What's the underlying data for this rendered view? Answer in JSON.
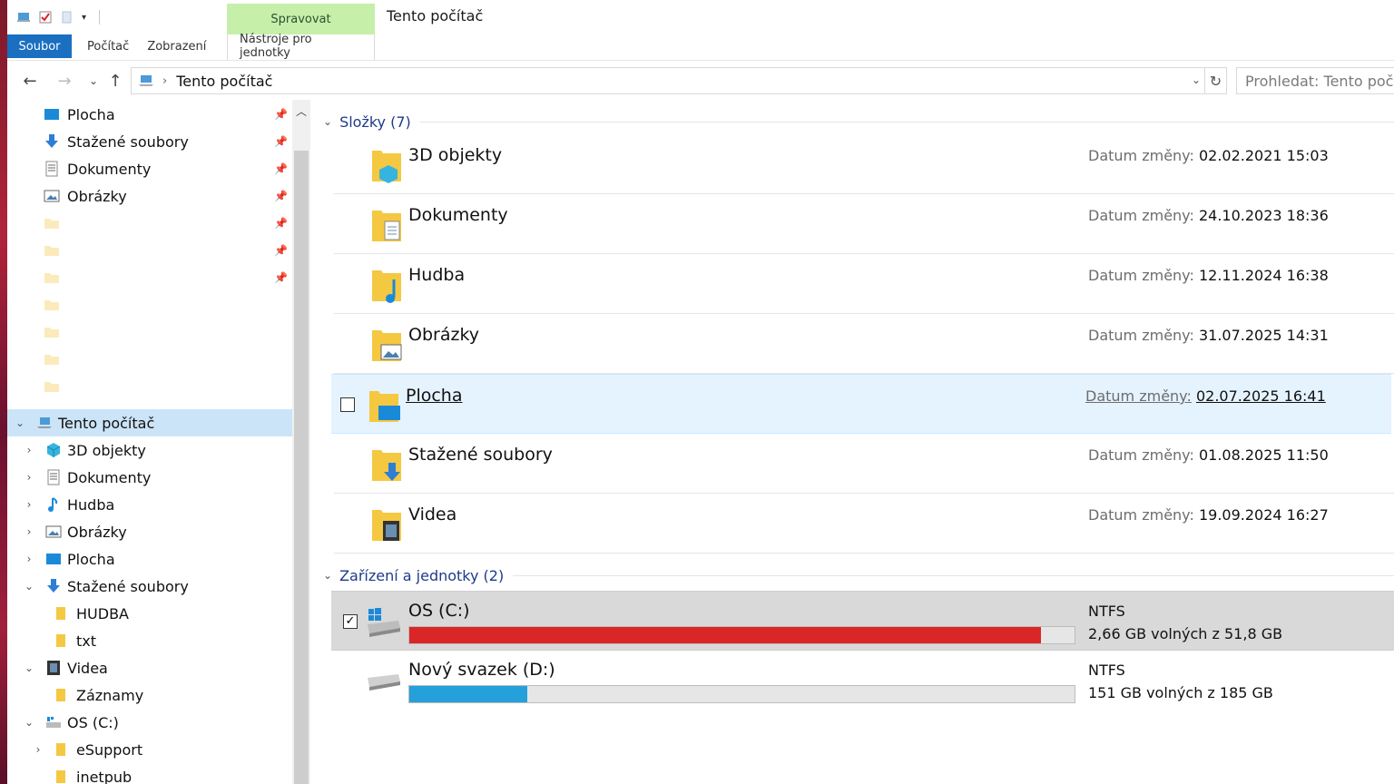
{
  "window": {
    "title": "Tento počítač"
  },
  "ribbon": {
    "context_group": "Spravovat",
    "tabs": [
      {
        "label": "Soubor"
      },
      {
        "label": "Počítač"
      },
      {
        "label": "Zobrazení"
      },
      {
        "label": "Nástroje pro jednotky"
      }
    ]
  },
  "address": {
    "breadcrumb": "Tento počítač",
    "search_placeholder": "Prohledat: Tento počítač"
  },
  "nav": {
    "quick_access": [
      {
        "label": "Plocha",
        "icon": "desktop-icon",
        "pinned": true
      },
      {
        "label": "Stažené soubory",
        "icon": "download-arrow-icon",
        "pinned": true
      },
      {
        "label": "Dokumenty",
        "icon": "document-icon",
        "pinned": true
      },
      {
        "label": "Obrázky",
        "icon": "picture-icon",
        "pinned": true
      }
    ],
    "this_pc": {
      "label": "Tento počítač"
    },
    "tree": [
      {
        "label": "3D objekty",
        "icon": "3d-cube-icon"
      },
      {
        "label": "Dokumenty",
        "icon": "document-icon"
      },
      {
        "label": "Hudba",
        "icon": "music-note-icon"
      },
      {
        "label": "Obrázky",
        "icon": "picture-icon"
      },
      {
        "label": "Plocha",
        "icon": "desktop-icon"
      },
      {
        "label": "Stažené soubory",
        "icon": "download-arrow-icon"
      },
      {
        "label": "HUDBA",
        "icon": "folder-icon"
      },
      {
        "label": "txt",
        "icon": "folder-icon"
      },
      {
        "label": "Videa",
        "icon": "film-icon"
      },
      {
        "label": "Záznamy",
        "icon": "folder-icon"
      },
      {
        "label": "OS (C:)",
        "icon": "drive-icon"
      },
      {
        "label": "eSupport",
        "icon": "folder-icon"
      },
      {
        "label": "inetpub",
        "icon": "folder-icon"
      }
    ]
  },
  "content": {
    "folders_header": "Složky (7)",
    "devices_header": "Zařízení a jednotky (2)",
    "date_label": "Datum změny:",
    "folders": [
      {
        "name": "3D objekty",
        "date": "02.02.2021 15:03",
        "icon": "3d-folder-icon"
      },
      {
        "name": "Dokumenty",
        "date": "24.10.2023 18:36",
        "icon": "documents-folder-icon"
      },
      {
        "name": "Hudba",
        "date": "12.11.2024 16:38",
        "icon": "music-folder-icon"
      },
      {
        "name": "Obrázky",
        "date": "31.07.2025 14:31",
        "icon": "pictures-folder-icon"
      },
      {
        "name": "Plocha",
        "date": "02.07.2025 16:41",
        "icon": "desktop-folder-icon"
      },
      {
        "name": "Stažené soubory",
        "date": "01.08.2025 11:50",
        "icon": "downloads-folder-icon"
      },
      {
        "name": "Videa",
        "date": "19.09.2024 16:27",
        "icon": "videos-folder-icon"
      }
    ],
    "drives": [
      {
        "name": "OS (C:)",
        "fs": "NTFS",
        "free": "2,66 GB volných z 51,8 GB",
        "used_fraction": 0.949,
        "bar_color": "#da2626",
        "icon": "windows-drive-icon"
      },
      {
        "name": "Nový svazek (D:)",
        "fs": "NTFS",
        "free": "151 GB volných z 185 GB",
        "used_fraction": 0.178,
        "bar_color": "#26a0da",
        "icon": "drive-icon"
      }
    ]
  },
  "colors": {
    "file_tab": "#1a6fc0",
    "context_tab": "#c6efaa",
    "selection": "#cce4f7",
    "link_blue": "#1e3a8a"
  }
}
